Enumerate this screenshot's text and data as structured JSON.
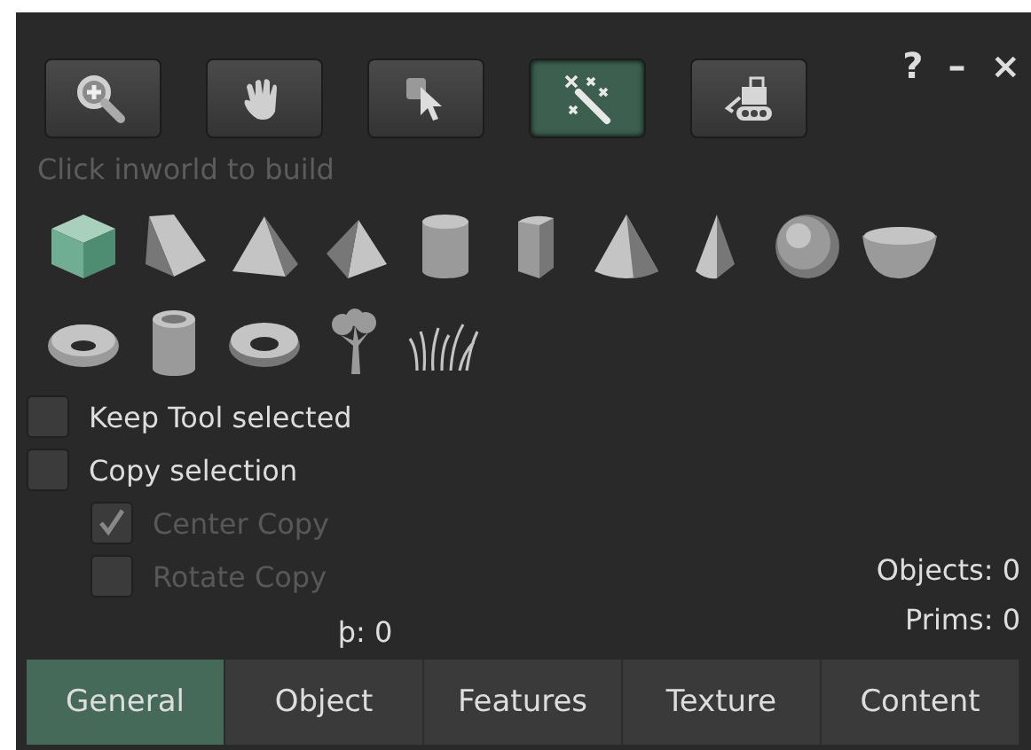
{
  "window": {
    "help": "?",
    "minimize": "–",
    "close": "×"
  },
  "tools": [
    {
      "selected": false
    },
    {
      "selected": false
    },
    {
      "selected": false
    },
    {
      "selected": true
    },
    {
      "selected": false
    }
  ],
  "hint": "Click inworld to build",
  "shapes": [
    {
      "selected": true
    },
    {
      "selected": false
    },
    {
      "selected": false
    },
    {
      "selected": false
    },
    {
      "selected": false
    },
    {
      "selected": false
    },
    {
      "selected": false
    },
    {
      "selected": false
    },
    {
      "selected": false
    },
    {
      "selected": false
    },
    {
      "selected": false
    },
    {
      "selected": false
    },
    {
      "selected": false
    },
    {
      "selected": false
    },
    {
      "selected": false
    }
  ],
  "options": [
    {
      "label": "Keep Tool selected",
      "checked": false,
      "disabled": false
    },
    {
      "label": "Copy selection",
      "checked": false,
      "disabled": false,
      "children": [
        {
          "label": "Center Copy",
          "checked": true,
          "disabled": true
        },
        {
          "label": "Rotate Copy",
          "checked": false,
          "disabled": true
        }
      ]
    }
  ],
  "cut_label": "þ: 0",
  "counts": [
    "Objects: 0",
    "Prims: 0"
  ],
  "tabs": [
    {
      "label": "General",
      "selected": true
    },
    {
      "label": "Object",
      "selected": false
    },
    {
      "label": "Features",
      "selected": false
    },
    {
      "label": "Texture",
      "selected": false
    },
    {
      "label": "Content",
      "selected": false
    }
  ]
}
